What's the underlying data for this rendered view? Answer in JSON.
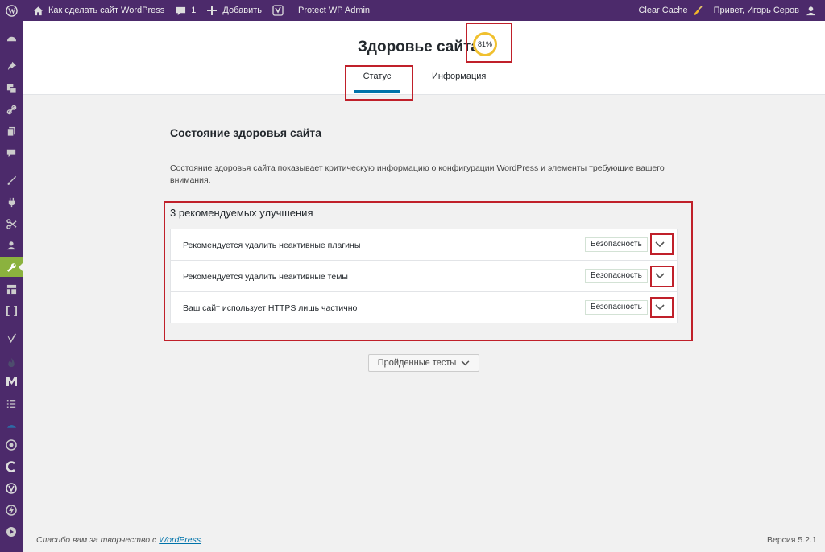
{
  "adminbar": {
    "site_name": "Как сделать сайт WordPress",
    "comments_count": "1",
    "add_new": "Добавить",
    "protect": "Protect WP Admin",
    "clear_cache": "Clear Cache",
    "greeting": "Привет, Игорь Серов"
  },
  "header": {
    "title": "Здоровье сайта",
    "score": "81%",
    "tabs": [
      {
        "label": "Статус",
        "active": true
      },
      {
        "label": "Информация",
        "active": false
      }
    ]
  },
  "main": {
    "section_title": "Состояние здоровья сайта",
    "description": "Состояние здоровья сайта показывает критическую информацию о конфигурации WordPress и элементы требующие вашего внимания.",
    "issues_title": "3 рекомендуемых улучшения",
    "issues": [
      {
        "label": "Рекомендуется удалить неактивные плагины",
        "badge": "Безопасность"
      },
      {
        "label": "Рекомендуется удалить неактивные темы",
        "badge": "Безопасность"
      },
      {
        "label": "Ваш сайт использует HTTPS лишь частично",
        "badge": "Безопасность"
      }
    ],
    "passed_tests_button": "Пройденные тесты"
  },
  "footer": {
    "thanks_prefix": "Спасибо вам за творчество с ",
    "thanks_link": "WordPress",
    "thanks_suffix": ".",
    "version": "Версия 5.2.1"
  },
  "colors": {
    "adminbar_bg": "#4c2a6b",
    "active_menu": "#8bb23e",
    "link": "#0073aa",
    "annotation_red": "#c0202a",
    "score_ring": "#f0c02f"
  },
  "sidemenu_icons": [
    "dashboard-icon",
    "pin-icon",
    "media-icon",
    "links-icon",
    "pages-icon",
    "comments-icon",
    "appearance-icon",
    "plugins-icon",
    "users-icon",
    "tools-icon",
    "settings-icon",
    "brackets-icon",
    "yoast-icon",
    "flame-icon",
    "m-icon",
    "list-icon",
    "rocket-icon",
    "eye-icon",
    "c-icon",
    "v-icon",
    "bolt-icon",
    "play-icon"
  ]
}
